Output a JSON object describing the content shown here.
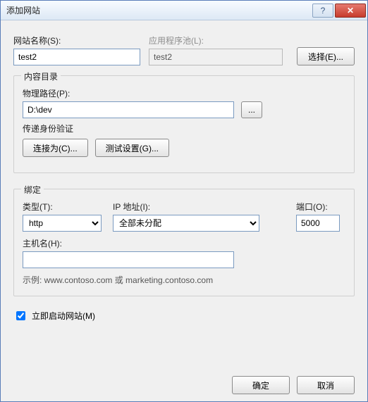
{
  "title": "添加网站",
  "site_name": {
    "label": "网站名称(S):",
    "value": "test2"
  },
  "app_pool": {
    "label": "应用程序池(L):",
    "value": "test2",
    "select_btn": "选择(E)..."
  },
  "content_group": {
    "legend": "内容目录",
    "phys_path": {
      "label": "物理路径(P):",
      "value": "D:\\dev"
    },
    "auth_label": "传递身份验证",
    "connect_as": "连接为(C)...",
    "test_settings": "测试设置(G)..."
  },
  "binding_group": {
    "legend": "绑定",
    "type": {
      "label": "类型(T):",
      "value": "http"
    },
    "ip": {
      "label": "IP 地址(I):",
      "value": "全部未分配"
    },
    "port": {
      "label": "端口(O):",
      "value": "5000"
    },
    "host": {
      "label": "主机名(H):",
      "value": ""
    },
    "example": "示例: www.contoso.com 或 marketing.contoso.com"
  },
  "autostart_label": "立即启动网站(M)",
  "ok": "确定",
  "cancel": "取消"
}
